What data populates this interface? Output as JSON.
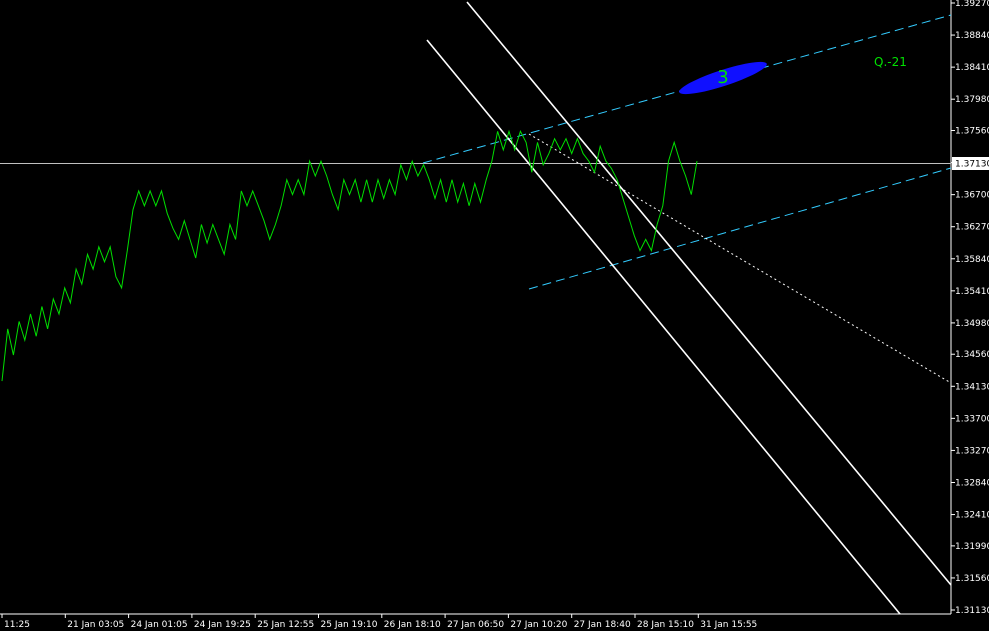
{
  "chart_data": {
    "type": "line",
    "series": [
      {
        "values": [
          1.342,
          1.349,
          1.3455,
          1.35,
          1.3475,
          1.351,
          1.348,
          1.352,
          1.349,
          1.353,
          1.351,
          1.3545,
          1.3525,
          1.357,
          1.355,
          1.359,
          1.357,
          1.36,
          1.358,
          1.36,
          1.356,
          1.3545,
          1.3595,
          1.365,
          1.3675,
          1.3655,
          1.3675,
          1.3655,
          1.3675,
          1.3645,
          1.3625,
          1.361,
          1.3635,
          1.361,
          1.3585,
          1.363,
          1.3605,
          1.363,
          1.361,
          1.359,
          1.363,
          1.361,
          1.3675,
          1.3655,
          1.3675,
          1.3655,
          1.3635,
          1.361,
          1.363,
          1.3655,
          1.369,
          1.367,
          1.369,
          1.367,
          1.3715,
          1.3695,
          1.3715,
          1.3695,
          1.367,
          1.365,
          1.369,
          1.367,
          1.369,
          1.366,
          1.369,
          1.366,
          1.369,
          1.3665,
          1.369,
          1.367,
          1.371,
          1.369,
          1.3715,
          1.3695,
          1.371,
          1.369,
          1.3665,
          1.369,
          1.366,
          1.369,
          1.366,
          1.3685,
          1.3655,
          1.3685,
          1.366,
          1.369,
          1.3715,
          1.3755,
          1.373,
          1.3755,
          1.373,
          1.3755,
          1.374,
          1.37,
          1.374,
          1.371,
          1.3725,
          1.3745,
          1.373,
          1.3745,
          1.3725,
          1.3745,
          1.3725,
          1.3715,
          1.37,
          1.3735,
          1.3715,
          1.3705,
          1.369,
          1.3665,
          1.364,
          1.3615,
          1.3595,
          1.361,
          1.3595,
          1.363,
          1.3655,
          1.3715,
          1.374,
          1.3715,
          1.3695,
          1.367,
          1.3715
        ]
      }
    ],
    "x_tick_labels": [
      "11:25",
      "21 Jan 03:05",
      "24 Jan 01:05",
      "24 Jan 19:25",
      "25 Jan 12:55",
      "25 Jan 19:10",
      "26 Jan 18:10",
      "27 Jan 06:50",
      "27 Jan 10:20",
      "27 Jan 18:40",
      "28 Jan 15:10",
      "31 Jan 15:55"
    ],
    "y_tick_labels": [
      "1.39270",
      "1.38840",
      "1.38410",
      "1.37980",
      "1.37560",
      "1.37130",
      "1.36700",
      "1.36270",
      "1.35840",
      "1.35410",
      "1.34980",
      "1.34560",
      "1.34130",
      "1.33700",
      "1.33270",
      "1.32840",
      "1.32410",
      "1.31990",
      "1.31560",
      "1.31130"
    ],
    "ylim": [
      1.3113,
      1.3927
    ],
    "current_price": "1.37130",
    "annotations": {
      "wave_label": "3",
      "q_label": "Q.-21"
    }
  },
  "colors": {
    "background": "#000000",
    "price_line": "#00e000",
    "channel_dashed": "#33ccff",
    "channel_solid": "#ffffff",
    "marker": "#1010ff",
    "text": "#ffffff"
  }
}
